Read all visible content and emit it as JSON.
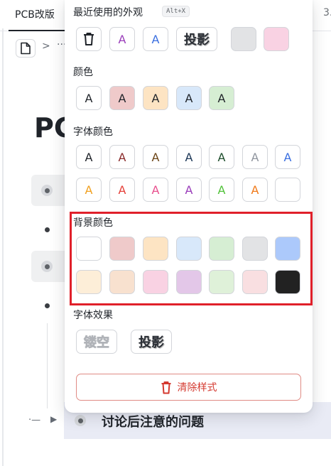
{
  "tab": {
    "title": "PCB改版",
    "extra": "3."
  },
  "breadcrumb": {
    "chevron": ">",
    "ellipsis": "···"
  },
  "page": {
    "title": "PC"
  },
  "bottom_item": {
    "dash": "·—",
    "arrow": "▶",
    "text": "讨论后注意的问题"
  },
  "popover": {
    "recent": {
      "label": "最近使用的外观",
      "shortcut": "Alt+X",
      "items": [
        {
          "type": "trash-icon"
        },
        {
          "type": "letter",
          "text": "A",
          "color": "#9a3dba"
        },
        {
          "type": "letter",
          "text": "A",
          "color": "#3a6fe0"
        },
        {
          "type": "text",
          "text": "投影"
        },
        {
          "type": "fill",
          "color": "#e2e3e5"
        },
        {
          "type": "fill",
          "color": "#f9d2e3"
        }
      ]
    },
    "color": {
      "label": "颜色",
      "items": [
        {
          "text": "A",
          "bg": "#ffffff"
        },
        {
          "text": "A",
          "bg": "#efcaca"
        },
        {
          "text": "A",
          "bg": "#fde4c3"
        },
        {
          "text": "A",
          "bg": "#d8e8fa"
        },
        {
          "text": "A",
          "bg": "#d6eed3"
        }
      ]
    },
    "font_color": {
      "label": "字体颜色",
      "row1": [
        {
          "text": "A",
          "color": "#1f2329"
        },
        {
          "text": "A",
          "color": "#8a2b2b"
        },
        {
          "text": "A",
          "color": "#6b4416"
        },
        {
          "text": "A",
          "color": "#1b3656"
        },
        {
          "text": "A",
          "color": "#1d4d2b"
        },
        {
          "text": "A",
          "color": "#8f959e"
        },
        {
          "text": "A",
          "color": "#3a6fe0"
        }
      ],
      "row2": [
        {
          "text": "A",
          "color": "#f0a020"
        },
        {
          "text": "A",
          "color": "#e5413a"
        },
        {
          "text": "A",
          "color": "#e8508e"
        },
        {
          "text": "A",
          "color": "#9a3dba"
        },
        {
          "text": "A",
          "color": "#52c23a"
        },
        {
          "text": "A",
          "color": "#f07a1a"
        },
        {
          "text": "",
          "color": "#ffffff"
        }
      ]
    },
    "bg_color": {
      "label": "背景颜色",
      "row1": [
        "#ffffff",
        "#efcaca",
        "#fde4c3",
        "#d8e8fa",
        "#d6eed3",
        "#e2e3e5",
        "#acc9fb"
      ],
      "row2": [
        "#fdeed8",
        "#f8e1cf",
        "#f9d2e3",
        "#e3c7e8",
        "#dff1d9",
        "#f9dfe1",
        "#222222"
      ]
    },
    "font_effect": {
      "label": "字体效果",
      "hollow": "镂空",
      "shadow": "投影"
    },
    "clear": {
      "label": "清除样式",
      "color": "#d4392f"
    }
  }
}
